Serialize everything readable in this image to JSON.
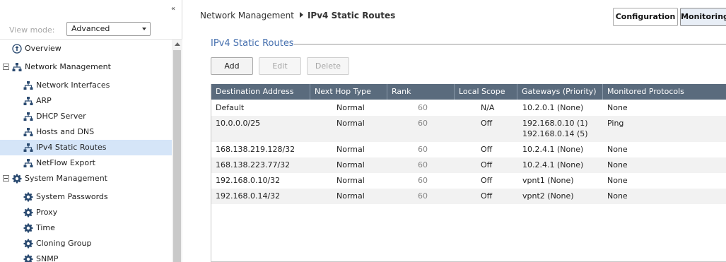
{
  "sidebar": {
    "collapse_glyph": "«",
    "view_mode_label": "View mode:",
    "view_mode_value": "Advanced",
    "items": [
      {
        "label": "Overview",
        "icon": "overview-icon"
      },
      {
        "label": "Network Management",
        "icon": "network-icon"
      },
      {
        "label": "Network Interfaces",
        "icon": "network-icon"
      },
      {
        "label": "ARP",
        "icon": "network-icon"
      },
      {
        "label": "DHCP Server",
        "icon": "network-icon"
      },
      {
        "label": "Hosts and DNS",
        "icon": "network-icon"
      },
      {
        "label": "IPv4 Static Routes",
        "icon": "network-icon",
        "selected": true
      },
      {
        "label": "NetFlow Export",
        "icon": "network-icon"
      },
      {
        "label": "System Management",
        "icon": "gear-icon"
      },
      {
        "label": "System Passwords",
        "icon": "gear-icon"
      },
      {
        "label": "Proxy",
        "icon": "gear-icon"
      },
      {
        "label": "Time",
        "icon": "gear-icon"
      },
      {
        "label": "Cloning Group",
        "icon": "gear-icon"
      },
      {
        "label": "SNMP",
        "icon": "gear-icon"
      }
    ]
  },
  "header": {
    "breadcrumb_parent": "Network Management",
    "breadcrumb_current": "IPv4 Static Routes",
    "tabs": {
      "configuration": "Configuration",
      "monitoring": "Monitoring"
    }
  },
  "main": {
    "section_title": "IPv4 Static Routes",
    "buttons": {
      "add": "Add",
      "edit": "Edit",
      "delete": "Delete"
    },
    "columns": [
      "Destination Address",
      "Next Hop Type",
      "Rank",
      "Local Scope",
      "Gateways (Priority)",
      "Monitored Protocols"
    ],
    "rows": [
      {
        "dest": "Default",
        "hop": "Normal",
        "rank": "60",
        "scope": "N/A",
        "gw1": "10.2.0.1 (None)",
        "gw2": "",
        "proto": "None"
      },
      {
        "dest": "10.0.0.0/25",
        "hop": "Normal",
        "rank": "60",
        "scope": "Off",
        "gw1": "192.168.0.10 (1)",
        "gw2": "192.168.0.14 (5)",
        "proto": "Ping"
      },
      {
        "dest": "168.138.219.128/32",
        "hop": "Normal",
        "rank": "60",
        "scope": "Off",
        "gw1": "10.2.4.1 (None)",
        "gw2": "",
        "proto": "None"
      },
      {
        "dest": "168.138.223.77/32",
        "hop": "Normal",
        "rank": "60",
        "scope": "Off",
        "gw1": "10.2.4.1 (None)",
        "gw2": "",
        "proto": "None"
      },
      {
        "dest": "192.168.0.10/32",
        "hop": "Normal",
        "rank": "60",
        "scope": "Off",
        "gw1": "vpnt1 (None)",
        "gw2": "",
        "proto": "None"
      },
      {
        "dest": "192.168.0.14/32",
        "hop": "Normal",
        "rank": "60",
        "scope": "Off",
        "gw1": "vpnt2 (None)",
        "gw2": "",
        "proto": "None"
      }
    ]
  },
  "colors": {
    "header_bg": "#5a6b7d",
    "title_blue": "#456fae",
    "selected_bg": "#d5e5f8",
    "rank_gray": "#888888"
  }
}
